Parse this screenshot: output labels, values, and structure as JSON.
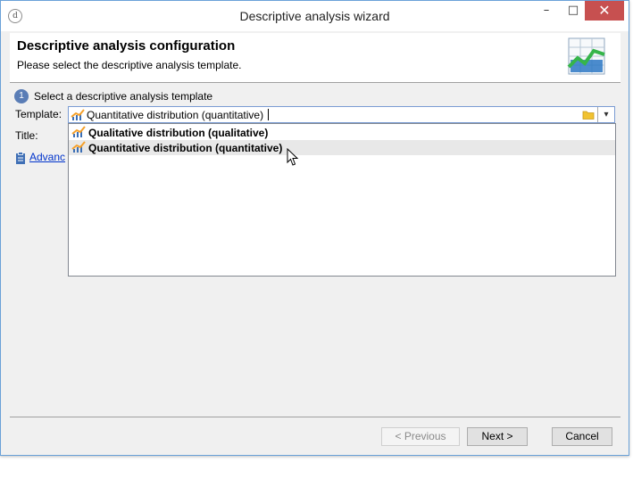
{
  "window": {
    "title": "Descriptive analysis wizard",
    "minimize_glyph": "–",
    "maximize_glyph": "□",
    "close_glyph": "✕"
  },
  "header": {
    "title": "Descriptive analysis configuration",
    "subtitle": "Please select the descriptive analysis template."
  },
  "step": {
    "number": "1",
    "label": "Select a descriptive analysis template"
  },
  "form": {
    "template_label": "Template:",
    "template_value": "Quantitative distribution (quantitative)",
    "title_label": "Title:",
    "advanced_link": "Advanc"
  },
  "dropdown": {
    "options": [
      {
        "label": "Qualitative distribution (qualitative)"
      },
      {
        "label": "Quantitative distribution (quantitative)"
      }
    ],
    "highlighted_option": "Quantitative distribution (quantitative)"
  },
  "buttons": {
    "previous": "< Previous",
    "next": "Next >",
    "cancel": "Cancel"
  },
  "icons": {
    "app": "app-logo-icon",
    "header": "chart-table-icon",
    "option": "chart-icon",
    "folder": "folder-icon",
    "advanced": "clipboard-icon"
  },
  "colors": {
    "accent": "#5a7db6",
    "link": "#0033cc",
    "close_button": "#c75050",
    "highlight": "#e8e8e8"
  }
}
